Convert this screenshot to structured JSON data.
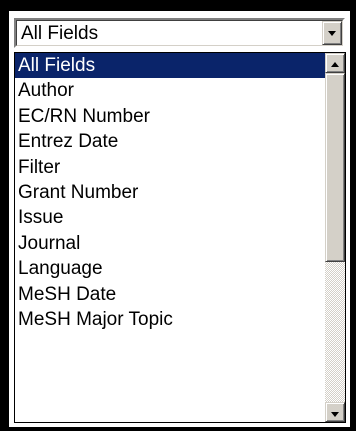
{
  "select": {
    "value": "All Fields",
    "options": [
      "All Fields",
      "Author",
      "EC/RN Number",
      "Entrez Date",
      "Filter",
      "Grant Number",
      "Issue",
      "Journal",
      "Language",
      "MeSH Date",
      "MeSH Major Topic"
    ],
    "selected_index": 0
  },
  "icons": {
    "dropdown": "chevron-down-icon",
    "scroll_up": "arrow-up-icon",
    "scroll_down": "arrow-down-icon"
  },
  "colors": {
    "selection_bg": "#0a246a",
    "selection_fg": "#ffffff",
    "button_face": "#d4d0c8"
  }
}
